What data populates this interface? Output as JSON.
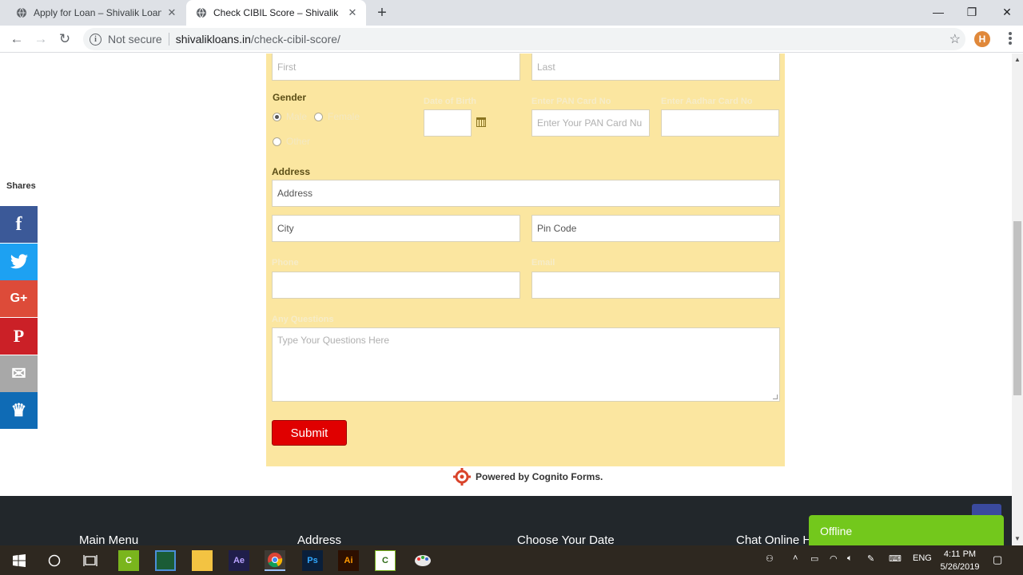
{
  "browser": {
    "tabs": [
      {
        "title": "Apply for Loan – Shivalik Loans",
        "active": false
      },
      {
        "title": "Check CIBIL Score – Shivalik Loans",
        "active": true
      }
    ],
    "security_label": "Not secure",
    "url_domain": "shivalikloans.in",
    "url_path": "/check-cibil-score/",
    "profile_initial": "H"
  },
  "form": {
    "name_first_placeholder": "First",
    "name_last_placeholder": "Last",
    "gender_label": "Gender",
    "gender_options": [
      "Male",
      "Female",
      "Other"
    ],
    "gender_selected": "Male",
    "dob_label": "Date of Birth",
    "pan_label": "Enter PAN Card No",
    "pan_placeholder": "Enter Your PAN Card Nu",
    "aadhar_label": "Enter Aadhar Card No",
    "address_label": "Address",
    "address_placeholder": "Address",
    "city_placeholder": "City",
    "pincode_placeholder": "Pin Code",
    "phone_label": "Phone",
    "email_label": "Email",
    "questions_label": "Any Questions",
    "questions_placeholder": "Type Your Questions Here",
    "submit_label": "Submit"
  },
  "powered_by": "Powered by Cognito Forms.",
  "shares": {
    "label": "Shares",
    "buttons": [
      {
        "name": "facebook",
        "glyph": "f",
        "color": "#3b5998"
      },
      {
        "name": "twitter",
        "glyph": "t",
        "color": "#1da1f2"
      },
      {
        "name": "google-plus",
        "glyph": "G+",
        "color": "#dd4b39"
      },
      {
        "name": "pinterest",
        "glyph": "P",
        "color": "#cb2027"
      },
      {
        "name": "email",
        "glyph": "✉",
        "color": "#a8a8a8"
      },
      {
        "name": "sumo",
        "glyph": "♛",
        "color": "#0f6bb5"
      }
    ]
  },
  "footer": {
    "columns": [
      "Main Menu",
      "Address",
      "Choose Your Date",
      "Chat Online H"
    ]
  },
  "chat": {
    "status": "Offline"
  },
  "taskbar": {
    "lang": "ENG",
    "time": "4:11 PM",
    "date": "5/26/2019",
    "apps": [
      "Camtasia",
      "Display",
      "File Explorer",
      "Ae",
      "Chrome",
      "Ps",
      "Ai",
      "Camtasia Recorder",
      "Paint"
    ]
  }
}
